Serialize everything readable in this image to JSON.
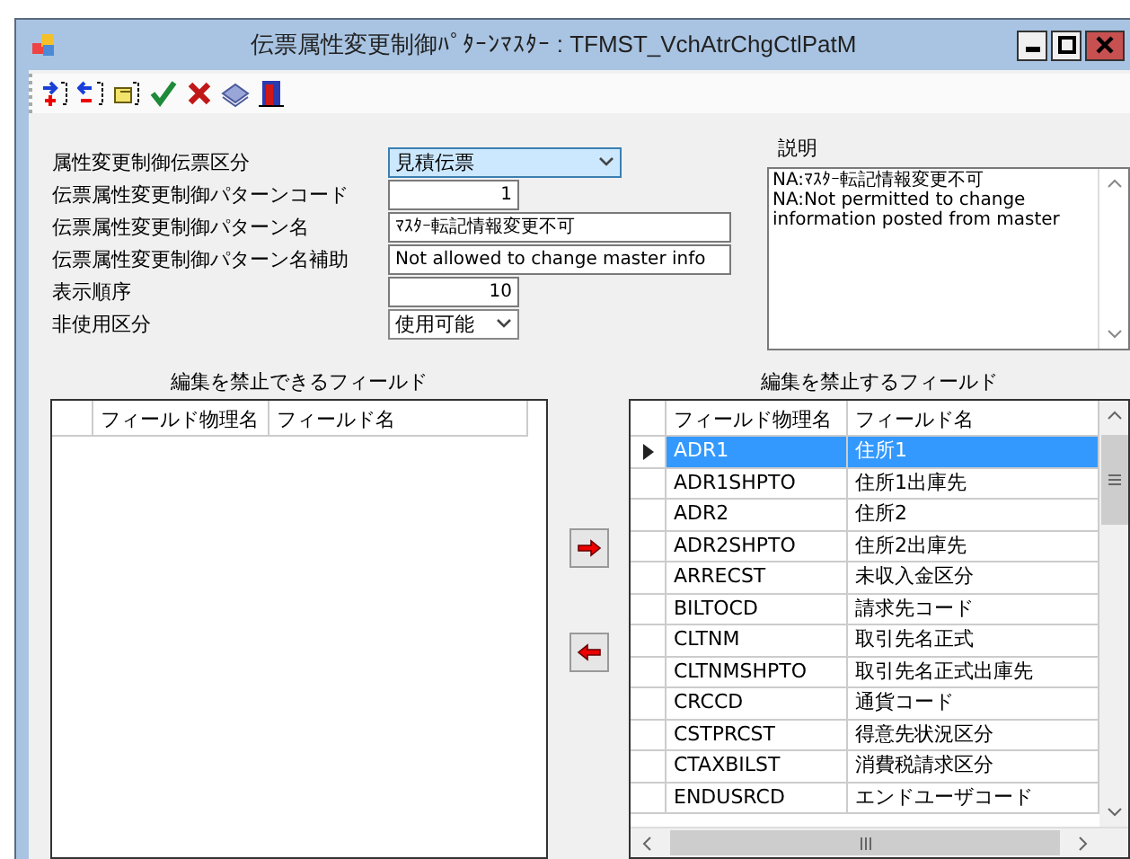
{
  "window": {
    "title": "伝票属性変更制御ﾊﾟﾀｰﾝﾏｽﾀｰ : TFMST_VchAtrChgCtlPatM"
  },
  "form_fields": [
    {
      "label": "属性変更制御伝票区分",
      "kind": "dropdown",
      "value": "見積伝票",
      "focused": true
    },
    {
      "label": "伝票属性変更制御パターンコード",
      "kind": "number",
      "value": "1"
    },
    {
      "label": "伝票属性変更制御パターン名",
      "kind": "text",
      "value": "ﾏｽﾀｰ転記情報変更不可"
    },
    {
      "label": "伝票属性変更制御パターン名補助",
      "kind": "text",
      "value": "Not allowed to change master info"
    },
    {
      "label": "表示順序",
      "kind": "number",
      "value": "10"
    },
    {
      "label": "非使用区分",
      "kind": "dropdown",
      "value": "使用可能",
      "focused": false
    }
  ],
  "description": {
    "label": "説明",
    "lines": [
      "NA:ﾏｽﾀｰ転記情報変更不可",
      "NA:Not permitted to change",
      "information posted from master"
    ]
  },
  "available_fields": {
    "title": "編集を禁止できるフィールド",
    "columns": [
      "フィールド物理名",
      "フィールド名"
    ]
  },
  "prohibited_fields": {
    "title": "編集を禁止するフィールド",
    "columns": [
      "フィールド物理名",
      "フィールド名"
    ],
    "rows": [
      {
        "physical_name": "ADR1",
        "name": "住所1",
        "selected": true
      },
      {
        "physical_name": "ADR1SHPTO",
        "name": "住所1出庫先",
        "selected": false
      },
      {
        "physical_name": "ADR2",
        "name": "住所2",
        "selected": false
      },
      {
        "physical_name": "ADR2SHPTO",
        "name": "住所2出庫先",
        "selected": false
      },
      {
        "physical_name": "ARRECST",
        "name": "未収入金区分",
        "selected": false
      },
      {
        "physical_name": "BILTOCD",
        "name": "請求先コード",
        "selected": false
      },
      {
        "physical_name": "CLTNM",
        "name": "取引先名正式",
        "selected": false
      },
      {
        "physical_name": "CLTNMSHPTO",
        "name": "取引先名正式出庫先",
        "selected": false
      },
      {
        "physical_name": "CRCCD",
        "name": "通貨コード",
        "selected": false
      },
      {
        "physical_name": "CSTPRCST",
        "name": "得意先状況区分",
        "selected": false
      },
      {
        "physical_name": "CTAXBILST",
        "name": "消費税請求区分",
        "selected": false
      },
      {
        "physical_name": "ENDUSRCD",
        "name": "エンドユーザコード",
        "selected": false
      }
    ]
  }
}
